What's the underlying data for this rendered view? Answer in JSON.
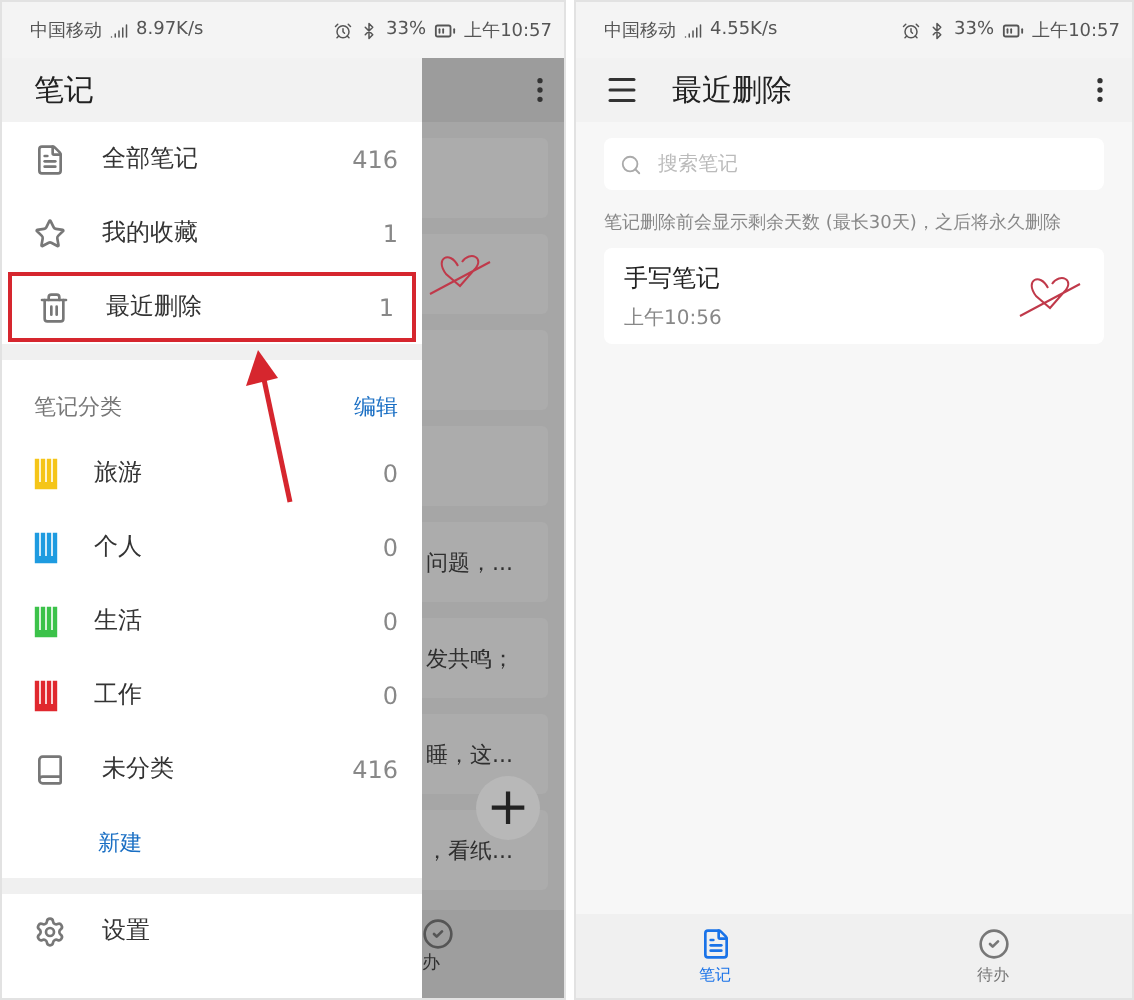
{
  "left_screen": {
    "status_bar": {
      "carrier": "中国移动",
      "speed": "8.97K/s",
      "battery": "33%",
      "time": "上午10:57"
    },
    "drawer": {
      "title": "笔记",
      "items": [
        {
          "kind": "all",
          "label": "全部笔记",
          "count": "416",
          "highlighted": false
        },
        {
          "kind": "star",
          "label": "我的收藏",
          "count": "1",
          "highlighted": false
        },
        {
          "kind": "trash",
          "label": "最近删除",
          "count": "1",
          "highlighted": true
        }
      ],
      "category_heading": "笔记分类",
      "edit_link": "编辑",
      "categories": [
        {
          "kind": "colored",
          "label": "旅游",
          "count": "0",
          "color": "#f5c518"
        },
        {
          "kind": "colored",
          "label": "个人",
          "count": "0",
          "color": "#1e9be0"
        },
        {
          "kind": "colored",
          "label": "生活",
          "count": "0",
          "color": "#3cc24a"
        },
        {
          "kind": "colored",
          "label": "工作",
          "count": "0",
          "color": "#e0282e"
        },
        {
          "kind": "plain",
          "label": "未分类",
          "count": "416"
        }
      ],
      "new_link": "新建",
      "settings": "设置"
    },
    "background_notes": [
      {
        "kind": "blank"
      },
      {
        "kind": "sketch"
      },
      {
        "kind": "blank"
      },
      {
        "kind": "blank"
      },
      {
        "kind": "text",
        "text": "问题，..."
      },
      {
        "kind": "text",
        "text": "发共鸣；"
      },
      {
        "kind": "text",
        "text": "睡，这..."
      },
      {
        "kind": "text",
        "text": "，看纸..."
      }
    ],
    "fab": "+",
    "tab_fragment": "办"
  },
  "right_screen": {
    "status_bar": {
      "carrier": "中国移动",
      "speed": "4.55K/s",
      "battery": "33%",
      "time": "上午10:57"
    },
    "title": "最近删除",
    "search": {
      "placeholder": "搜索笔记"
    },
    "notice": "笔记删除前会显示剩余天数 (最长30天)，之后将永久删除",
    "notes": [
      {
        "title": "手写笔记",
        "time": "上午10:56"
      }
    ],
    "tabs": [
      {
        "label": "笔记",
        "kind": "notes",
        "selected": true
      },
      {
        "label": "待办",
        "kind": "todo",
        "selected": false
      }
    ]
  }
}
